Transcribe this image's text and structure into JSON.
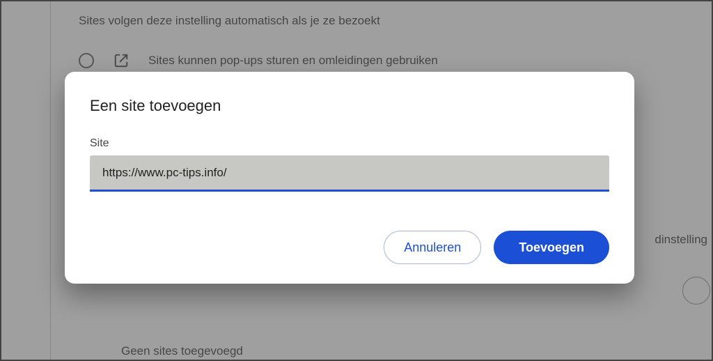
{
  "background": {
    "description": "Sites volgen deze instelling automatisch als je ze bezoekt",
    "option_allow": "Sites kunnen pop-ups sturen en omleidingen gebruiken",
    "right_fragment": "dinstelling",
    "hidden_fragment": "···· ·········· ·· ··· ··· ·· ····· · ············· ·· ·······",
    "none_added": "Geen sites toegevoegd"
  },
  "dialog": {
    "title": "Een site toevoegen",
    "field_label": "Site",
    "site_value": "https://www.pc-tips.info/",
    "cancel": "Annuleren",
    "add": "Toevoegen"
  }
}
